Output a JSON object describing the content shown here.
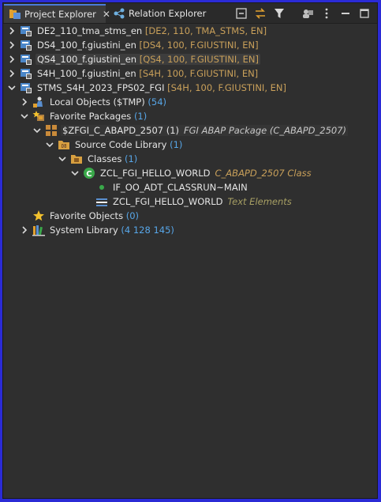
{
  "tabs": [
    {
      "label": "Project Explorer",
      "close": "✕"
    },
    {
      "label": "Relation Explorer"
    }
  ],
  "toolbar": {
    "icons": [
      "collapse-all-icon",
      "link-with-editor-icon",
      "filter-icon",
      "group-icon",
      "view-menu-icon",
      "minimize-icon",
      "maximize-icon"
    ]
  },
  "tree": {
    "projects": [
      {
        "name": "DE2_110_tma_stms_en",
        "meta": "[DE2, 110, TMA_STMS, EN]"
      },
      {
        "name": "DS4_100_f.giustini_en",
        "meta": "[DS4, 100, F.GIUSTINI, EN]"
      },
      {
        "name": "QS4_100_f.giustini_en",
        "meta": "[QS4, 100, F.GIUSTINI, EN]"
      },
      {
        "name": "S4H_100_f.giustini_en",
        "meta": "[S4H, 100, F.GIUSTINI, EN]"
      },
      {
        "name": "STMS_S4H_2023_FPS02_FGI",
        "meta": "[S4H, 100, F.GIUSTINI, EN]"
      }
    ],
    "local_objects": {
      "name": "Local Objects ($TMP)",
      "count": "(54)"
    },
    "favorite_packages": {
      "name": "Favorite Packages",
      "count": "(1)"
    },
    "package": {
      "name": "$ZFGI_C_ABAPD_2507",
      "count": "(1)",
      "desc": "FGI ABAP Package (C_ABAPD_2507)"
    },
    "source_library": {
      "name": "Source Code Library",
      "count": "(1)"
    },
    "classes": {
      "name": "Classes",
      "count": "(1)"
    },
    "class": {
      "name": "ZCL_FGI_HELLO_WORLD",
      "desc": "C_ABAPD_2507 Class"
    },
    "method": {
      "name": "IF_OO_ADT_CLASSRUN~MAIN"
    },
    "text_elements": {
      "name": "ZCL_FGI_HELLO_WORLD",
      "desc": "Text Elements"
    },
    "favorite_objects": {
      "name": "Favorite Objects",
      "count": "(0)"
    },
    "system_library": {
      "name": "System Library",
      "count": "(4 128 145)"
    }
  },
  "colors": {
    "accent": "#4a7ad8",
    "meta": "#c9a05a",
    "count": "#57a6e8"
  }
}
